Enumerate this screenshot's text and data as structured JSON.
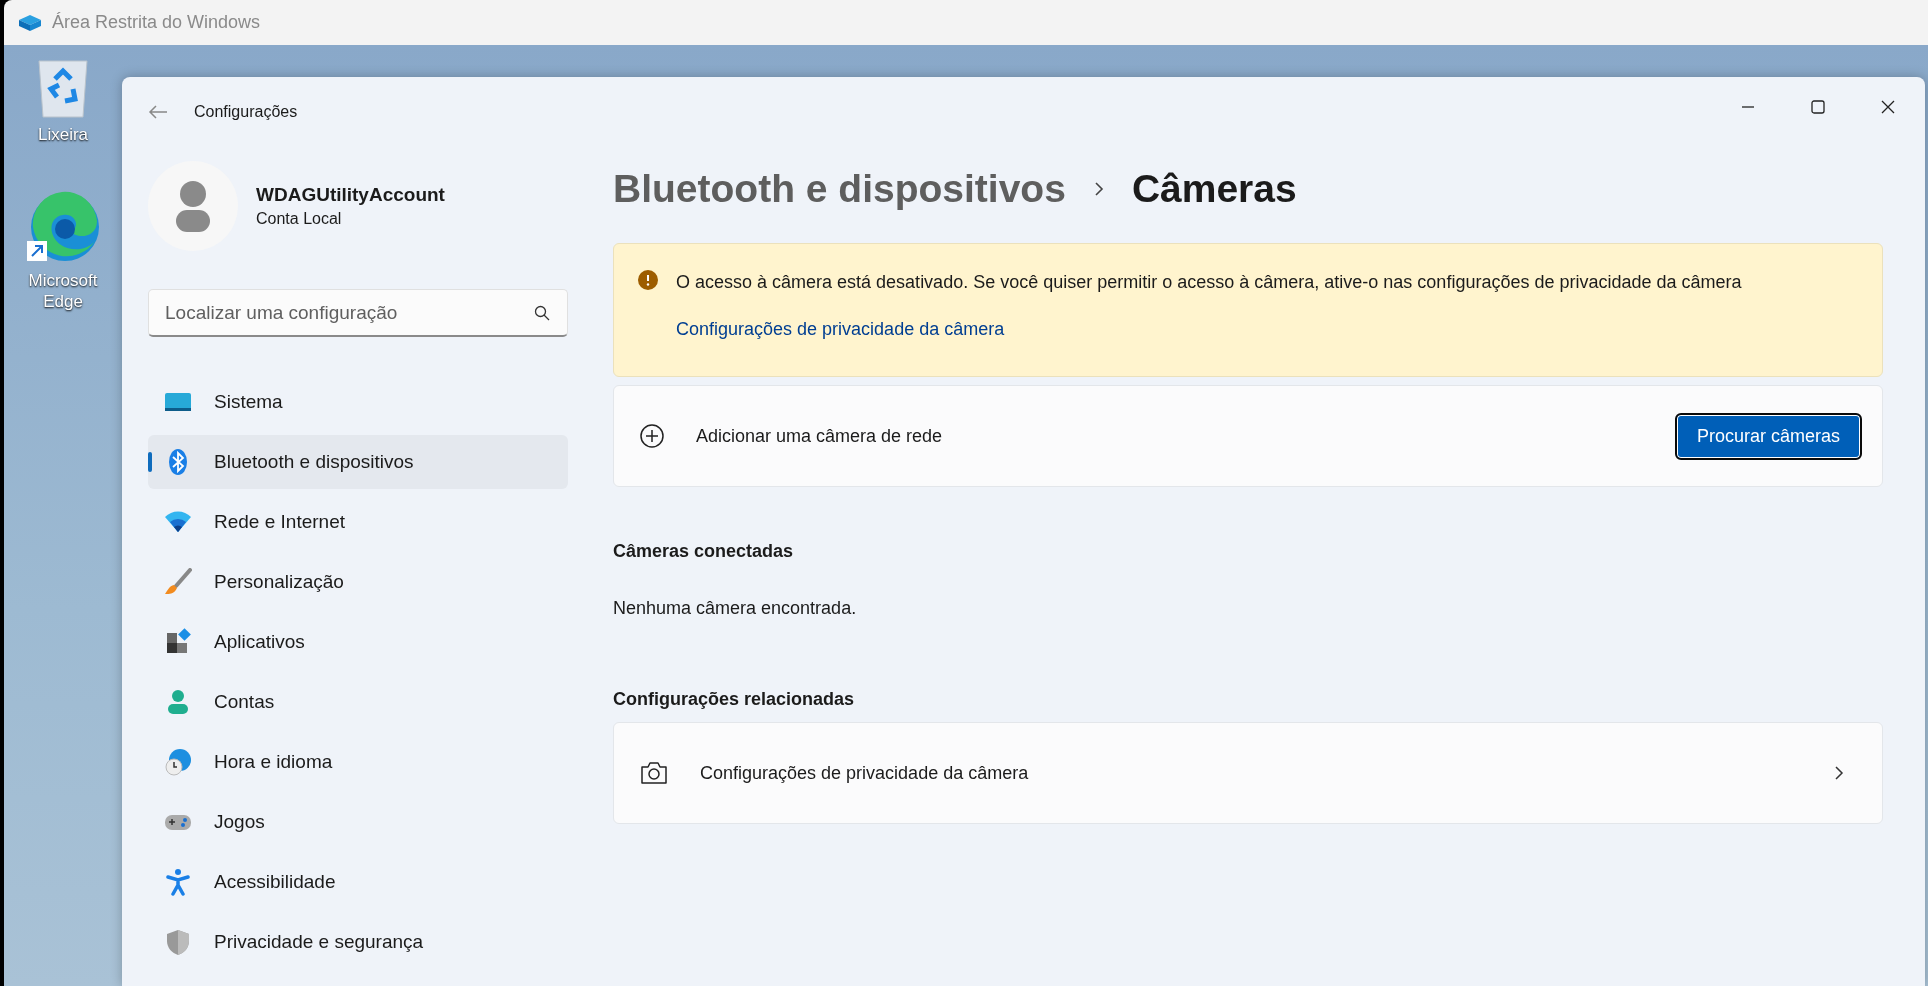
{
  "outer_window": {
    "title": "Área Restrita do Windows"
  },
  "desktop_icons": [
    {
      "label": "Lixeira",
      "kind": "recycle"
    },
    {
      "label": "Microsoft Edge",
      "kind": "edge"
    }
  ],
  "settings": {
    "title": "Configurações"
  },
  "account": {
    "name": "WDAGUtilityAccount",
    "type": "Conta Local"
  },
  "search": {
    "placeholder": "Localizar uma configuração"
  },
  "nav": [
    {
      "label": "Sistema",
      "kind": "system",
      "selected": false
    },
    {
      "label": "Bluetooth e dispositivos",
      "kind": "bluetooth",
      "selected": true
    },
    {
      "label": "Rede e Internet",
      "kind": "network",
      "selected": false
    },
    {
      "label": "Personalização",
      "kind": "brush",
      "selected": false
    },
    {
      "label": "Aplicativos",
      "kind": "apps",
      "selected": false
    },
    {
      "label": "Contas",
      "kind": "accounts",
      "selected": false
    },
    {
      "label": "Hora e idioma",
      "kind": "time",
      "selected": false
    },
    {
      "label": "Jogos",
      "kind": "games",
      "selected": false
    },
    {
      "label": "Acessibilidade",
      "kind": "accessibility",
      "selected": false
    },
    {
      "label": "Privacidade e segurança",
      "kind": "privacy",
      "selected": false
    }
  ],
  "breadcrumb": {
    "parent": "Bluetooth e dispositivos",
    "current": "Câmeras"
  },
  "warning": {
    "message": "O acesso à câmera está desativado. Se você quiser permitir o acesso à câmera, ative-o nas configurações de privacidade da câmera",
    "link": "Configurações de privacidade da câmera"
  },
  "add_camera": {
    "label": "Adicionar uma câmera de rede",
    "button": "Procurar câmeras"
  },
  "connected": {
    "heading": "Câmeras conectadas",
    "empty": "Nenhuma câmera encontrada."
  },
  "related": {
    "heading": "Configurações relacionadas",
    "items": [
      {
        "label": "Configurações de privacidade da câmera"
      }
    ]
  }
}
